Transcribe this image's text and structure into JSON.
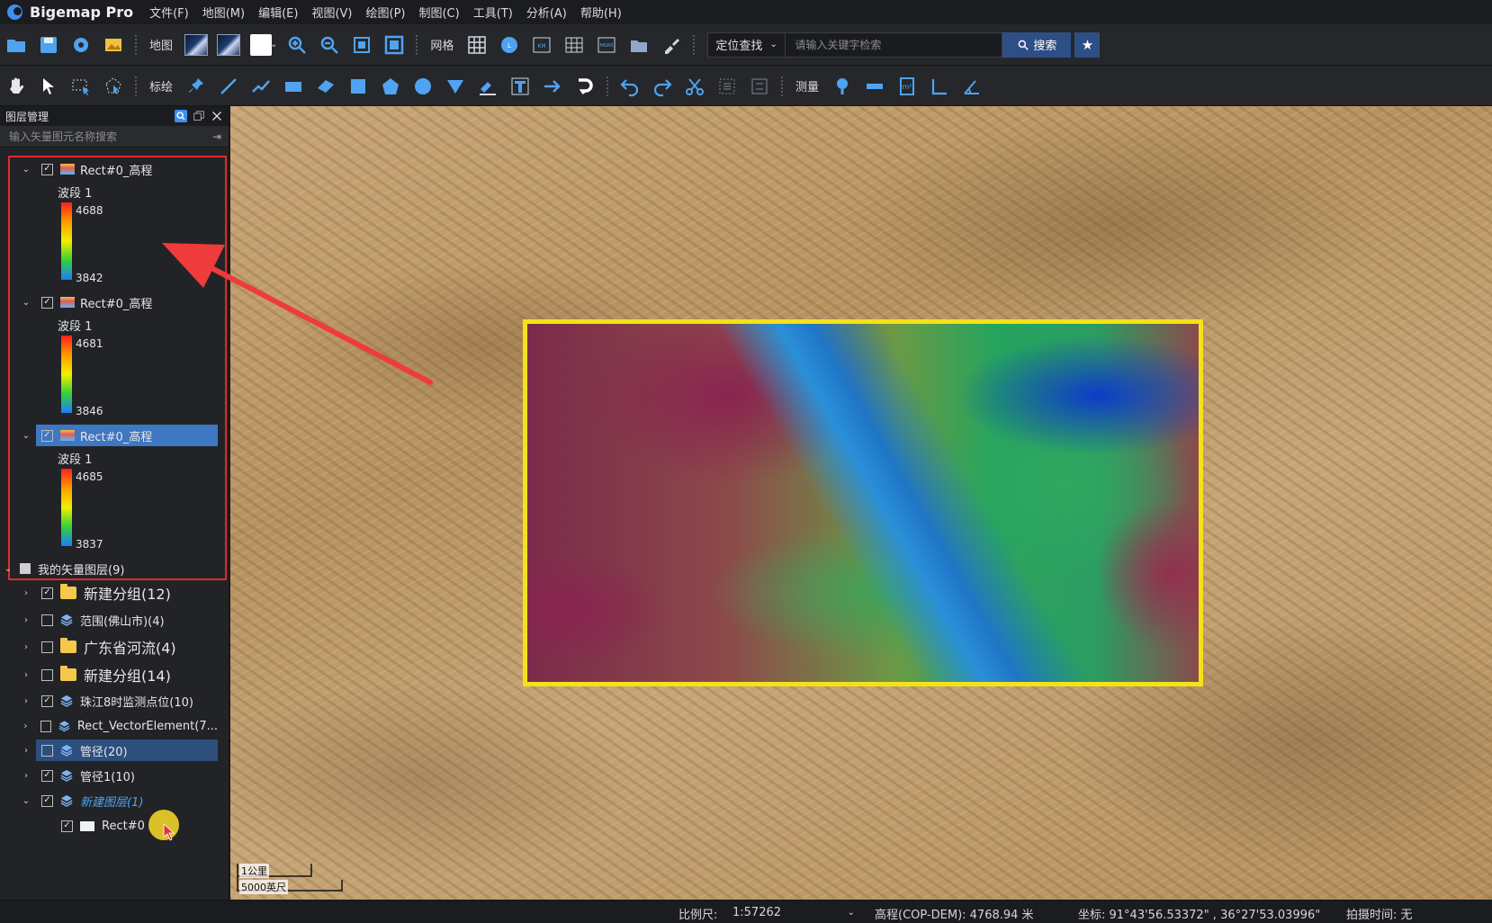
{
  "app": {
    "title": "Bigemap Pro"
  },
  "menu": [
    "文件(F)",
    "地图(M)",
    "编辑(E)",
    "视图(V)",
    "绘图(P)",
    "制图(C)",
    "工具(T)",
    "分析(A)",
    "帮助(H)"
  ],
  "toolbar1": {
    "map_label": "地图",
    "grid_label": "网格",
    "locate_select": "定位查找",
    "search_placeholder": "请输入关键字检索",
    "search_button": "搜索"
  },
  "toolbar2": {
    "draw_label": "标绘",
    "measure_label": "测量"
  },
  "panel": {
    "title": "图层管理",
    "search_placeholder": "输入矢量图元名称搜索",
    "rasters": [
      {
        "name": "Rect#0_高程",
        "band": "波段 1",
        "max": "4688",
        "min": "3842",
        "checked": true,
        "selected": false
      },
      {
        "name": "Rect#0_高程",
        "band": "波段 1",
        "max": "4681",
        "min": "3846",
        "checked": true,
        "selected": false
      },
      {
        "name": "Rect#0_高程",
        "band": "波段 1",
        "max": "4685",
        "min": "3837",
        "checked": true,
        "selected": true
      }
    ],
    "vector_root": "我的矢量图层(9)",
    "vector_layers": [
      {
        "name": "新建分组(12)",
        "type": "folder",
        "checked": true
      },
      {
        "name": "范围(佛山市)(4)",
        "type": "layer",
        "checked": false
      },
      {
        "name": "广东省河流(4)",
        "type": "folder",
        "checked": false
      },
      {
        "name": "新建分组(14)",
        "type": "folder",
        "checked": false
      },
      {
        "name": "珠江8时监测点位(10)",
        "type": "layer",
        "checked": true
      },
      {
        "name": "Rect_VectorElement(7...",
        "type": "layer",
        "checked": false
      },
      {
        "name": "管径(20)",
        "type": "layer",
        "checked": false
      },
      {
        "name": "管径1(10)",
        "type": "layer",
        "checked": true
      },
      {
        "name": "新建图层(1)",
        "type": "layer",
        "checked": true
      }
    ],
    "child_item": "Rect#0"
  },
  "map": {
    "scale_top": "1公里",
    "scale_bottom": "5000英尺"
  },
  "status": {
    "scale_label": "比例尺:",
    "scale_value": "1:57262",
    "elevation": "高程(COP-DEM): 4768.94 米",
    "coords": "坐标: 91°43'56.53372\" , 36°27'53.03996\"",
    "capture_time": "拍摄时间: 无"
  }
}
